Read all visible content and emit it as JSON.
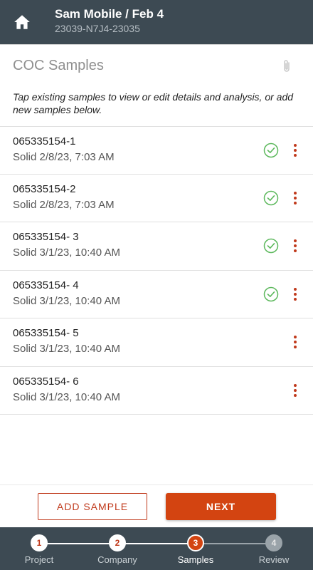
{
  "header": {
    "home_icon": "home-icon",
    "title": "Sam Mobile / Feb 4",
    "subtitle": "23039-N7J4-23035"
  },
  "section": {
    "title": "COC Samples",
    "attachment_icon": "paperclip-icon",
    "instructions": "Tap existing samples to view or edit details and analysis, or add new samples below."
  },
  "samples": [
    {
      "id": "065335154-1",
      "detail": "Solid 2/8/23, 7:03 AM",
      "checked": true
    },
    {
      "id": "065335154-2",
      "detail": "Solid 2/8/23, 7:03 AM",
      "checked": true
    },
    {
      "id": "065335154- 3",
      "detail": "Solid 3/1/23, 10:40 AM",
      "checked": true
    },
    {
      "id": "065335154- 4",
      "detail": "Solid 3/1/23, 10:40 AM",
      "checked": true
    },
    {
      "id": "065335154- 5",
      "detail": "Solid 3/1/23, 10:40 AM",
      "checked": false
    },
    {
      "id": "065335154- 6",
      "detail": "Solid 3/1/23, 10:40 AM",
      "checked": false
    }
  ],
  "actions": {
    "add_label": "ADD SAMPLE",
    "next_label": "NEXT"
  },
  "stepper": {
    "steps": [
      {
        "number": "1",
        "label": "Project",
        "state": "done"
      },
      {
        "number": "2",
        "label": "Company",
        "state": "done"
      },
      {
        "number": "3",
        "label": "Samples",
        "state": "current"
      },
      {
        "number": "4",
        "label": "Review",
        "state": "pending"
      }
    ]
  },
  "colors": {
    "header_bg": "#3d4a53",
    "accent": "#d34411",
    "check_green": "#5cb85c",
    "kebab_red": "#c0391b"
  }
}
